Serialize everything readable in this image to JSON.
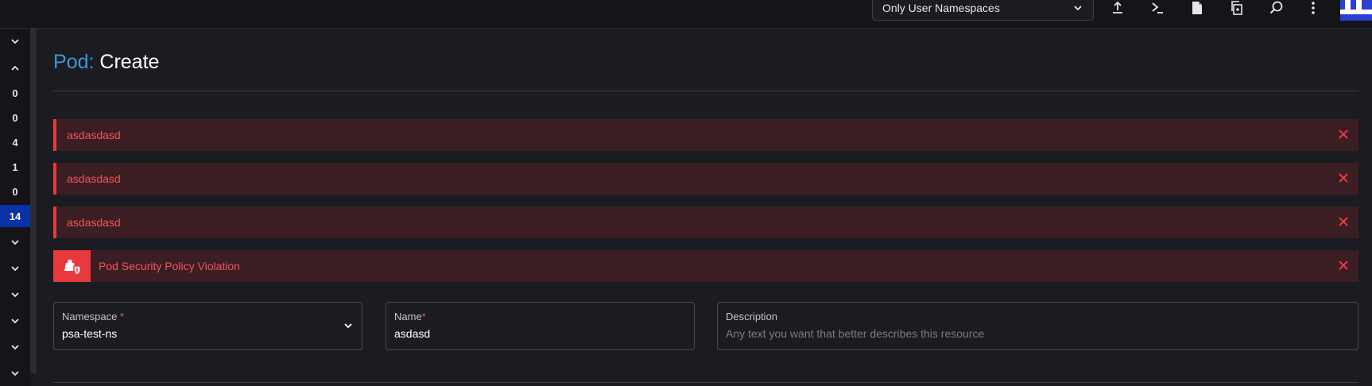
{
  "topbar": {
    "namespace_filter": "Only User Namespaces",
    "icons": [
      "upload-icon",
      "terminal-icon",
      "file-icon",
      "copy-icon",
      "search-icon",
      "more-vertical-icon"
    ]
  },
  "sidebar": {
    "items": [
      {
        "type": "chevron-down-icon"
      },
      {
        "type": "chevron-up-icon"
      },
      {
        "label": "0"
      },
      {
        "label": "0"
      },
      {
        "label": "4"
      },
      {
        "label": "1"
      },
      {
        "label": "0"
      },
      {
        "label": "14",
        "active": true
      },
      {
        "type": "chevron-down-icon"
      },
      {
        "type": "chevron-down-icon"
      },
      {
        "type": "chevron-down-icon"
      },
      {
        "type": "chevron-down-icon"
      },
      {
        "type": "chevron-down-icon"
      },
      {
        "type": "chevron-down-icon"
      }
    ]
  },
  "header": {
    "kind": "Pod:",
    "action": "Create"
  },
  "banners": [
    {
      "text": "asdasdasd"
    },
    {
      "text": "asdasdasd"
    },
    {
      "text": "asdasdasd"
    },
    {
      "text": "Pod Security Policy Violation",
      "icon": "shield-alert-icon"
    }
  ],
  "form": {
    "namespace": {
      "label": "Namespace",
      "required": "*",
      "value": "psa-test-ns"
    },
    "name": {
      "label": "Name",
      "required": "*",
      "value": "asdasd"
    },
    "description": {
      "label": "Description",
      "placeholder": "Any text you want that better describes this resource"
    }
  },
  "colors": {
    "accent_blue": "#3d98d3",
    "error_red": "#e8393f",
    "active_sidebar": "#0b31a8"
  }
}
